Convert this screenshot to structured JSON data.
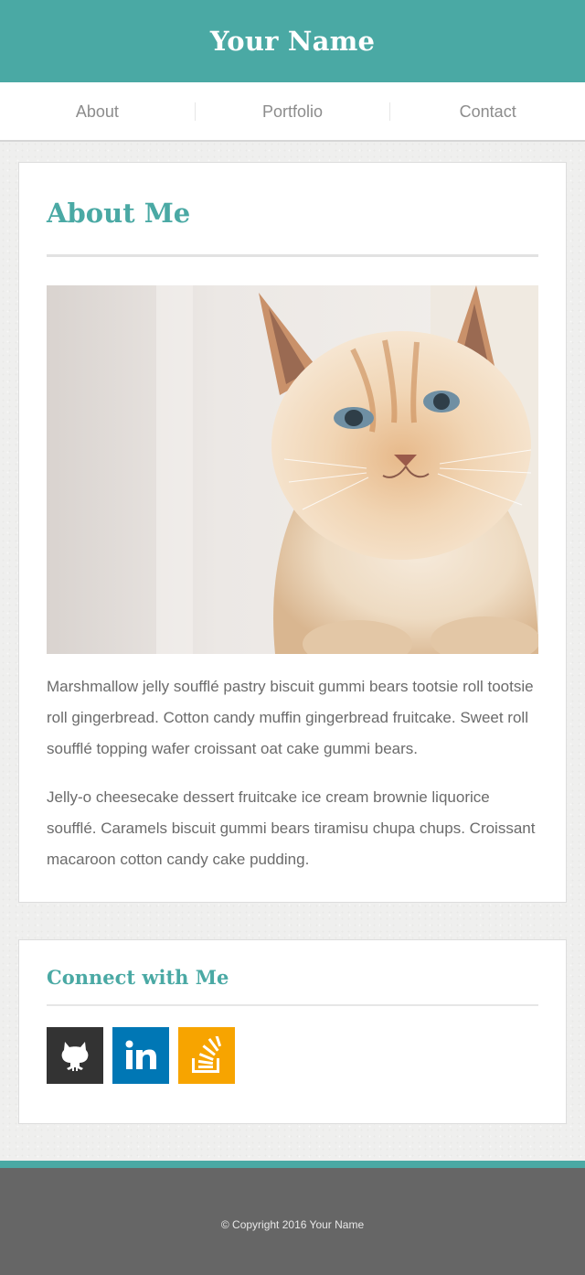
{
  "header": {
    "title": "Your Name"
  },
  "nav": {
    "items": [
      "About",
      "Portfolio",
      "Contact"
    ]
  },
  "about": {
    "heading": "About Me",
    "image_alt": "cat photo",
    "paragraphs": [
      "Marshmallow jelly soufflé pastry biscuit gummi bears tootsie roll tootsie roll gingerbread. Cotton candy muffin gingerbread fruitcake. Sweet roll soufflé topping wafer croissant oat cake gummi bears.",
      "Jelly-o cheesecake dessert fruitcake ice cream brownie liquorice soufflé. Caramels biscuit gummi bears tiramisu chupa chups. Croissant macaroon cotton candy cake pudding."
    ]
  },
  "connect": {
    "heading": "Connect with Me",
    "links": [
      {
        "icon": "github-icon",
        "color": "#333333"
      },
      {
        "icon": "linkedin-icon",
        "color": "#0077b5"
      },
      {
        "icon": "stackoverflow-icon",
        "color": "#f7a400"
      }
    ]
  },
  "footer": {
    "copyright": "© Copyright 2016 Your Name"
  },
  "colors": {
    "accent": "#4aa9a4",
    "footer_bg": "#666666",
    "text": "#6b6b6b"
  }
}
